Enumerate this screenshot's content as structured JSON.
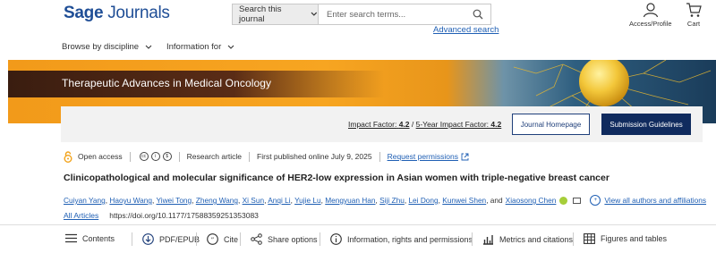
{
  "header": {
    "logo_bold": "Sage",
    "logo_rest": "Journals",
    "search_scope": "Search this journal",
    "search_placeholder": "Enter search terms...",
    "advanced_search": "Advanced search",
    "access_label": "Access/Profile",
    "cart_label": "Cart"
  },
  "nav": {
    "browse": "Browse by discipline",
    "info": "Information for"
  },
  "banner": {
    "journal_title": "Therapeutic Advances in Medical Oncology"
  },
  "card": {
    "impact_label": "Impact Factor:",
    "impact_value": "4.2",
    "five_year_label": "5-Year Impact Factor:",
    "five_year_value": "4.2",
    "homepage_button": "Journal Homepage",
    "submission_button": "Submission Guidelines"
  },
  "meta": {
    "open_access": "Open access",
    "article_type": "Research article",
    "published": "First published online July 9, 2025",
    "permissions": "Request permissions"
  },
  "article": {
    "title": "Clinicopathological and molecular significance of HER2-low expression in Asian women with triple-negative breast cancer",
    "authors": [
      "Cuiyan Yang",
      "Haoyu Wang",
      "Yiwei Tong",
      "Zheng Wang",
      "Xi Sun",
      "Anqi Li",
      "Yujie Lu",
      "Mengyuan Han",
      "Siji Zhu",
      "Lei Dong",
      "Kunwei Shen"
    ],
    "and_text": ", and",
    "last_author": "Xiaosong Chen",
    "view_all": "View all authors and affiliations",
    "all_articles": "All Articles",
    "doi": "https://doi.org/10.1177/17588359251353083"
  },
  "toolbar": {
    "contents": "Contents",
    "pdf": "PDF/EPUB",
    "cite": "Cite",
    "share": "Share options",
    "info": "Information, rights and permissions",
    "metrics": "Metrics and citations",
    "figures": "Figures and tables"
  },
  "colors": {
    "brand": "#1f4e96",
    "link": "#1f5fb4",
    "banner_orange": "#f29a1a",
    "button_navy": "#102b5e",
    "open_access": "#f2a31b"
  }
}
